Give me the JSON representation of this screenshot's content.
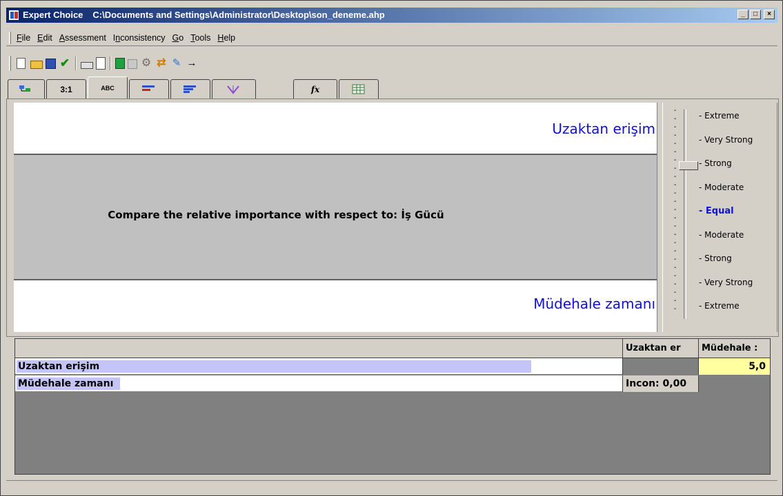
{
  "window": {
    "app_name": "Expert Choice",
    "path": "C:\\Documents and Settings\\Administrator\\Desktop\\son_deneme.ahp",
    "minimize": "_",
    "maximize": "□",
    "close": "×"
  },
  "menu": [
    {
      "label": "File",
      "key": "F"
    },
    {
      "label": "Edit",
      "key": "E"
    },
    {
      "label": "Assessment",
      "key": "A"
    },
    {
      "label": "Inconsistency",
      "key": "n"
    },
    {
      "label": "Go",
      "key": "G"
    },
    {
      "label": "Tools",
      "key": "T"
    },
    {
      "label": "Help",
      "key": "H"
    }
  ],
  "toolbar": {
    "icons": [
      "new-icon",
      "open-icon",
      "save-icon",
      "check-icon",
      "print-icon",
      "print-preview-icon",
      "calculator-icon",
      "model-icon",
      "gear-icon",
      "swap-icon",
      "tools-icon",
      "arrow-icon"
    ]
  },
  "tabs": [
    {
      "label": "",
      "icon": "tree-icon"
    },
    {
      "label": "3:1",
      "icon": "numerical-icon"
    },
    {
      "label": "ABC",
      "icon": "verbal-icon",
      "active": true
    },
    {
      "label": "",
      "icon": "bar-chart-icon"
    },
    {
      "label": "",
      "icon": "sorted-bars-icon"
    },
    {
      "label": "",
      "icon": "sensitivity-icon"
    },
    {
      "label": "fx",
      "icon": "formula-icon"
    },
    {
      "label": "",
      "icon": "grid-icon"
    }
  ],
  "comparison": {
    "top_element": "Uzaktan erişim",
    "question": "Compare the relative importance with respect to: İş Gücü",
    "bottom_element": "Müdehale zamanı"
  },
  "scale": {
    "labels": [
      "Extreme",
      "Very Strong",
      "Strong",
      "Moderate",
      "Equal",
      "Moderate",
      "Strong",
      "Very Strong",
      "Extreme"
    ],
    "selected": "Strong",
    "selected_index": 2
  },
  "results": {
    "columns": [
      "",
      "Uzaktan er",
      "Müdehale :"
    ],
    "rows": [
      {
        "name": "Uzaktan erişim",
        "priority": 0.833,
        "c1": "",
        "c2": "5,0"
      },
      {
        "name": "Müdehale zamanı",
        "priority": 0.167,
        "c1": "Incon: 0,00",
        "c2": ""
      }
    ]
  },
  "colors": {
    "title_gradient_start": "#0a246a",
    "element_text": "#1010d8",
    "bar": "#c4c4f8",
    "highlight_cell": "#ffffa0"
  }
}
